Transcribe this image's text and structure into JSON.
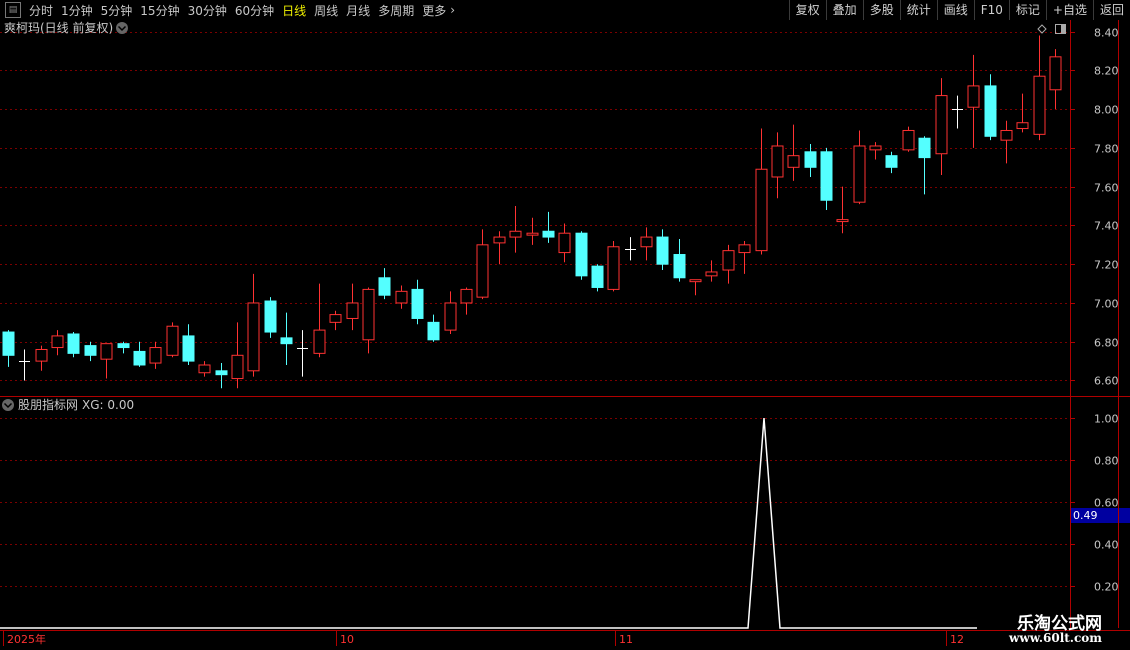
{
  "toolbar": {
    "periods": [
      "分时",
      "1分钟",
      "5分钟",
      "15分钟",
      "30分钟",
      "60分钟",
      "日线",
      "周线",
      "月线",
      "多周期",
      "更多"
    ],
    "active_period": "日线",
    "tools": [
      "复权",
      "叠加",
      "多股",
      "统计",
      "画线",
      "F10",
      "标记",
      "+自选",
      "返回"
    ]
  },
  "main_panel": {
    "title": "爽柯玛(日线 前复权)"
  },
  "sub_panel": {
    "title": "股朋指标网",
    "indicator_label": "XG: 0.00",
    "cursor_value": "0.49"
  },
  "time_axis": {
    "labels": [
      "2025年",
      "10",
      "11",
      "12"
    ]
  },
  "watermark": {
    "line1": "乐淘公式网",
    "line2": "www.60lt.com"
  },
  "colors": {
    "up": "#ff3232",
    "down": "#54ffff",
    "grid": "#7a0000",
    "axis_text": "#c8c8c8",
    "indicator_line": "#ffffff"
  },
  "chart_data": [
    {
      "type": "candlestick",
      "y_ticks": [
        6.6,
        6.8,
        7.0,
        7.2,
        7.4,
        7.6,
        7.8,
        8.0,
        8.2,
        8.4
      ],
      "ylim": [
        6.52,
        8.46
      ],
      "ohlc": [
        [
          6.85,
          6.86,
          6.67,
          6.73
        ],
        [
          6.7,
          6.76,
          6.6,
          6.7
        ],
        [
          6.7,
          6.78,
          6.65,
          6.76
        ],
        [
          6.77,
          6.86,
          6.73,
          6.83
        ],
        [
          6.84,
          6.85,
          6.72,
          6.74
        ],
        [
          6.78,
          6.8,
          6.7,
          6.73
        ],
        [
          6.71,
          6.79,
          6.61,
          6.79
        ],
        [
          6.79,
          6.8,
          6.74,
          6.77
        ],
        [
          6.75,
          6.8,
          6.67,
          6.68
        ],
        [
          6.69,
          6.8,
          6.66,
          6.77
        ],
        [
          6.73,
          6.9,
          6.72,
          6.88
        ],
        [
          6.83,
          6.89,
          6.68,
          6.7
        ],
        [
          6.64,
          6.7,
          6.62,
          6.68
        ],
        [
          6.65,
          6.69,
          6.56,
          6.63
        ],
        [
          6.61,
          6.9,
          6.56,
          6.73
        ],
        [
          6.65,
          7.15,
          6.62,
          7.0
        ],
        [
          7.01,
          7.03,
          6.82,
          6.85
        ],
        [
          6.82,
          6.95,
          6.68,
          6.79
        ],
        [
          6.77,
          6.86,
          6.62,
          6.77
        ],
        [
          6.74,
          7.1,
          6.72,
          6.86
        ],
        [
          6.9,
          6.96,
          6.86,
          6.94
        ],
        [
          6.92,
          7.1,
          6.86,
          7.0
        ],
        [
          6.81,
          7.08,
          6.74,
          7.07
        ],
        [
          7.13,
          7.18,
          7.02,
          7.04
        ],
        [
          7.0,
          7.09,
          6.97,
          7.06
        ],
        [
          7.07,
          7.12,
          6.89,
          6.92
        ],
        [
          6.9,
          6.94,
          6.8,
          6.81
        ],
        [
          6.86,
          7.06,
          6.84,
          7.0
        ],
        [
          7.0,
          7.08,
          6.94,
          7.07
        ],
        [
          7.03,
          7.38,
          7.02,
          7.3
        ],
        [
          7.31,
          7.37,
          7.2,
          7.34
        ],
        [
          7.34,
          7.5,
          7.26,
          7.37
        ],
        [
          7.35,
          7.44,
          7.3,
          7.36
        ],
        [
          7.37,
          7.47,
          7.31,
          7.34
        ],
        [
          7.26,
          7.41,
          7.21,
          7.36
        ],
        [
          7.36,
          7.37,
          7.12,
          7.14
        ],
        [
          7.19,
          7.2,
          7.06,
          7.08
        ],
        [
          7.07,
          7.32,
          7.06,
          7.29
        ],
        [
          7.28,
          7.34,
          7.22,
          7.28
        ],
        [
          7.29,
          7.39,
          7.22,
          7.34
        ],
        [
          7.34,
          7.38,
          7.17,
          7.2
        ],
        [
          7.25,
          7.33,
          7.11,
          7.13
        ],
        [
          7.11,
          7.12,
          7.04,
          7.12
        ],
        [
          7.14,
          7.22,
          7.11,
          7.16
        ],
        [
          7.17,
          7.3,
          7.1,
          7.27
        ],
        [
          7.26,
          7.32,
          7.15,
          7.3
        ],
        [
          7.27,
          7.9,
          7.25,
          7.69
        ],
        [
          7.65,
          7.88,
          7.54,
          7.81
        ],
        [
          7.7,
          7.92,
          7.63,
          7.76
        ],
        [
          7.78,
          7.82,
          7.65,
          7.7
        ],
        [
          7.78,
          7.8,
          7.48,
          7.53
        ],
        [
          7.42,
          7.6,
          7.36,
          7.43
        ],
        [
          7.52,
          7.89,
          7.51,
          7.81
        ],
        [
          7.79,
          7.83,
          7.74,
          7.81
        ],
        [
          7.76,
          7.78,
          7.67,
          7.7
        ],
        [
          7.79,
          7.91,
          7.78,
          7.89
        ],
        [
          7.85,
          7.86,
          7.56,
          7.75
        ],
        [
          7.77,
          8.16,
          7.66,
          8.07
        ],
        [
          8.0,
          8.07,
          7.9,
          8.0
        ],
        [
          8.01,
          8.28,
          7.8,
          8.12
        ],
        [
          8.12,
          8.18,
          7.84,
          7.86
        ],
        [
          7.84,
          7.94,
          7.72,
          7.89
        ],
        [
          7.9,
          8.08,
          7.88,
          7.93
        ],
        [
          7.87,
          8.38,
          7.84,
          8.17
        ],
        [
          8.1,
          8.31,
          8.0,
          8.27
        ]
      ]
    },
    {
      "type": "line",
      "series_label": "XG",
      "y_ticks": [
        0.2,
        0.4,
        0.6,
        0.8,
        1.0
      ],
      "ylim": [
        0.0,
        1.1
      ],
      "values": [
        0,
        0,
        0,
        0,
        0,
        0,
        0,
        0,
        0,
        0,
        0,
        0,
        0,
        0,
        0,
        0,
        0,
        0,
        0,
        0,
        0,
        0,
        0,
        0,
        0,
        0,
        0,
        0,
        0,
        0,
        0,
        0,
        0,
        0,
        0,
        0,
        0,
        0,
        0,
        0,
        0,
        0,
        0,
        0,
        0,
        0,
        1,
        0,
        0,
        0,
        0,
        0,
        0,
        0,
        0,
        0,
        0,
        0,
        0,
        0
      ]
    }
  ]
}
